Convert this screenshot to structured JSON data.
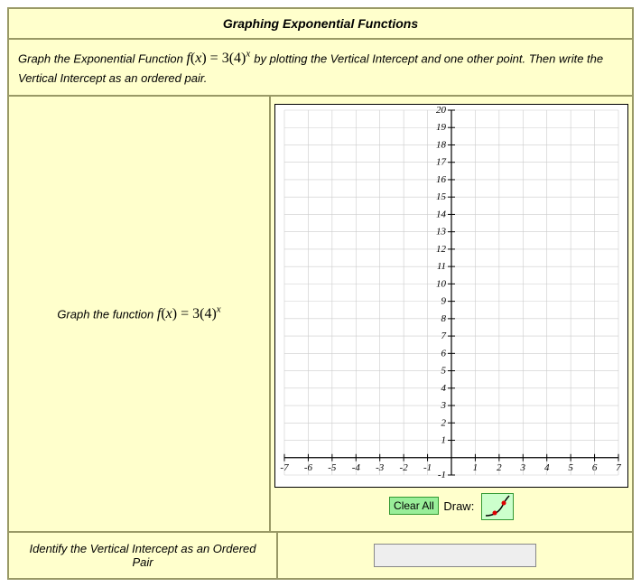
{
  "title": "Graphing Exponential Functions",
  "instructions_pre": "Graph the Exponential Function ",
  "instructions_post": " by plotting the Vertical Intercept and one other point. Then write the Vertical Intercept as an ordered pair.",
  "func_label_pre": "Graph the function ",
  "formula_fn": "f",
  "formula_lp": "(",
  "formula_var": "x",
  "formula_rp": ")",
  "formula_eq": " = ",
  "formula_coef": "3",
  "formula_base_open": "(",
  "formula_base": "4",
  "formula_base_close": ")",
  "formula_exp": "x",
  "clear_label": "Clear All",
  "draw_label": "Draw:",
  "vi_prompt": "Identify the Vertical Intercept as an Ordered Pair",
  "answer_value": "",
  "chart_data": {
    "type": "scatter",
    "title": "",
    "xlabel": "",
    "ylabel": "",
    "xlim": [
      -7,
      7
    ],
    "ylim": [
      -1,
      20
    ],
    "xticks": [
      -7,
      -6,
      -5,
      -4,
      -3,
      -2,
      -1,
      1,
      2,
      3,
      4,
      5,
      6,
      7
    ],
    "yticks": [
      -1,
      1,
      2,
      3,
      4,
      5,
      6,
      7,
      8,
      9,
      10,
      11,
      12,
      13,
      14,
      15,
      16,
      17,
      18,
      19,
      20
    ],
    "grid": true,
    "series": []
  }
}
